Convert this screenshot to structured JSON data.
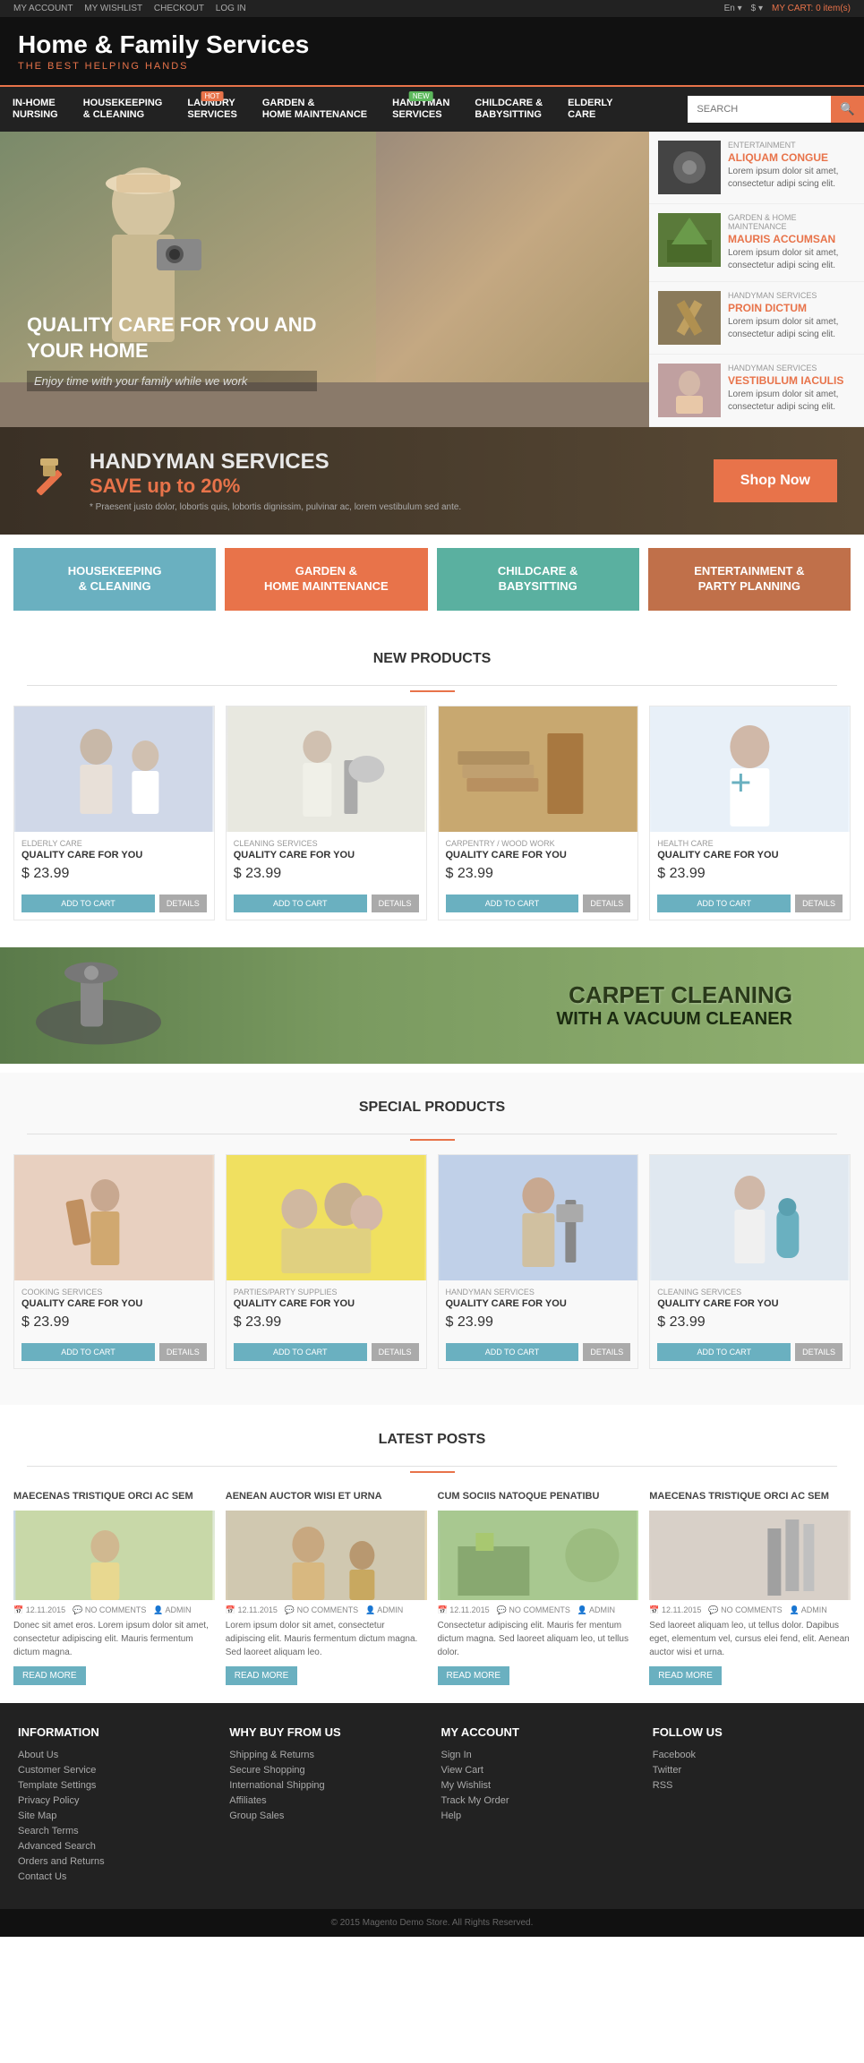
{
  "topbar": {
    "links": [
      "MY ACCOUNT",
      "MY WISHLIST",
      "CHECKOUT",
      "LOG IN"
    ],
    "language": "En ▾",
    "currency": "$ ▾",
    "cart_label": "MY CART:",
    "cart_items": "0 item(s)"
  },
  "header": {
    "title": "Home & Family Services",
    "subtitle": "THE BEST HELPING HANDS"
  },
  "nav": {
    "items": [
      {
        "label": "IN-HOME\nNURSING",
        "badge": ""
      },
      {
        "label": "HOUSEKEEPING\n& CLEANING",
        "badge": ""
      },
      {
        "label": "LAUNDRY\nSERVICES",
        "badge": "HOT"
      },
      {
        "label": "GARDEN &\nHOME MAINTENANCE",
        "badge": ""
      },
      {
        "label": "HANDYMAN\nSERVICES",
        "badge": "NEW"
      },
      {
        "label": "CHILDCARE &\nBABYSITTING",
        "badge": ""
      },
      {
        "label": "ELDERLY\nCARE",
        "badge": ""
      }
    ],
    "search_placeholder": "SEARCH"
  },
  "hero": {
    "title": "QUALITY CARE FOR YOU AND\nYOUR HOME",
    "subtitle": "Enjoy time with your family while we work",
    "sidebar_items": [
      {
        "category": "ENTERTAINMENT",
        "title": "ALIQUAM CONGUE",
        "text": "Lorem ipsum dolor sit amet, consectetur adipi scing elit."
      },
      {
        "category": "GARDEN & HOME MAINTENANCE",
        "title": "MAURIS ACCUMSAN",
        "text": "Lorem ipsum dolor sit amet, consectetur adipi scing elit."
      },
      {
        "category": "HANDYMAN SERVICES",
        "title": "PROIN DICTUM",
        "text": "Lorem ipsum dolor sit amet, consectetur adipi scing elit."
      },
      {
        "category": "HANDYMAN SERVICES",
        "title": "VESTIBULUM IACULIS",
        "text": "Lorem ipsum dolor sit amet, consectetur adipi scing elit."
      }
    ]
  },
  "banner": {
    "line1": "HANDYMAN SERVICES",
    "line2_prefix": "SAVE up to ",
    "line2_highlight": "20%",
    "subtext": "* Praesent justo dolor, lobortis quis, lobortis dignissim, pulvinar ac, lorem vestibulum sed ante.",
    "button": "Shop Now"
  },
  "categories": [
    {
      "label": "HOUSEKEEPING\n& CLEANING",
      "color": "cat-box-blue"
    },
    {
      "label": "GARDEN &\nHOME MAINTENANCE",
      "color": "cat-box-orange"
    },
    {
      "label": "CHILDCARE &\nBABYSITTING",
      "color": "cat-box-teal"
    },
    {
      "label": "ENTERTAINMENT &\nPARTY PLANNING",
      "color": "cat-box-brown"
    }
  ],
  "new_products": {
    "title": "NEW PRODUCTS",
    "items": [
      {
        "category": "ELDERLY CARE",
        "name": "QUALITY CARE FOR YOU",
        "price": "$ 23.99"
      },
      {
        "category": "CLEANING SERVICES",
        "name": "QUALITY CARE FOR YOU",
        "price": "$ 23.99"
      },
      {
        "category": "CARPENTRY / WOOD WORK",
        "name": "QUALITY CARE FOR YOU",
        "price": "$ 23.99"
      },
      {
        "category": "HEALTH CARE",
        "name": "QUALITY CARE FOR YOU",
        "price": "$ 23.99"
      }
    ],
    "btn_cart": "ADD TO CART",
    "btn_details": "DETAILS"
  },
  "carpet_banner": {
    "line1": "CARPET CLEANING",
    "line2": "WITH A VACUUM CLEANER"
  },
  "special_products": {
    "title": "SPECIAL PRODUCTS",
    "items": [
      {
        "category": "COOKING SERVICES",
        "name": "QUALITY CARE FOR YOU",
        "price": "$ 23.99"
      },
      {
        "category": "PARTIES/PARTY SUPPLIES",
        "name": "QUALITY CARE FOR YOU",
        "price": "$ 23.99"
      },
      {
        "category": "HANDYMAN SERVICES",
        "name": "QUALITY CARE FOR YOU",
        "price": "$ 23.99"
      },
      {
        "category": "CLEANING SERVICES",
        "name": "QUALITY CARE FOR YOU",
        "price": "$ 23.99"
      }
    ],
    "btn_cart": "ADD TO CART",
    "btn_details": "DETAILS"
  },
  "latest_posts": {
    "title": "LATEST POSTS",
    "posts": [
      {
        "title": "MAECENAS TRISTIQUE ORCI AC SEM",
        "date": "12.11.2015",
        "comments": "NO COMMENTS",
        "author": "ADMIN",
        "text": "Donec sit amet eros. Lorem ipsum dolor sit amet, consectetur adipiscing elit. Mauris fermentum dictum magna."
      },
      {
        "title": "AENEAN AUCTOR WISI ET URNA",
        "date": "12.11.2015",
        "comments": "NO COMMENTS",
        "author": "ADMIN",
        "text": "Lorem ipsum dolor sit amet, consectetur adipiscing elit. Mauris fermentum dictum magna. Sed laoreet aliquam leo."
      },
      {
        "title": "CUM SOCIIS NATOQUE PENATIBU",
        "date": "12.11.2015",
        "comments": "NO COMMENTS",
        "author": "ADMIN",
        "text": "Consectetur adipiscing elit. Mauris fer mentum dictum magna. Sed laoreet aliquam leo, ut tellus dolor."
      },
      {
        "title": "MAECENAS TRISTIQUE ORCI AC SEM",
        "date": "12.11.2015",
        "comments": "NO COMMENTS",
        "author": "ADMIN",
        "text": "Sed laoreet aliquam leo, ut tellus dolor. Dapibus eget, elementum vel, cursus elei fend, elit. Aenean auctor wisi et urna."
      }
    ],
    "btn_read_more": "READ MORE"
  },
  "footer": {
    "cols": [
      {
        "title": "INFORMATION",
        "links": [
          "About Us",
          "Customer Service",
          "Template Settings",
          "Privacy Policy",
          "Site Map",
          "Search Terms",
          "Advanced Search",
          "Orders and Returns",
          "Contact Us"
        ]
      },
      {
        "title": "WHY BUY FROM US",
        "links": [
          "Shipping & Returns",
          "Secure Shopping",
          "International Shipping",
          "Affiliates",
          "Group Sales"
        ]
      },
      {
        "title": "MY ACCOUNT",
        "links": [
          "Sign In",
          "View Cart",
          "My Wishlist",
          "Track My Order",
          "Help"
        ]
      },
      {
        "title": "FOLLOW US",
        "links": [
          "Facebook",
          "Twitter",
          "RSS"
        ]
      }
    ]
  },
  "footer_bottom": {
    "text": "© 2015 Magento Demo Store. All Rights Reserved."
  }
}
